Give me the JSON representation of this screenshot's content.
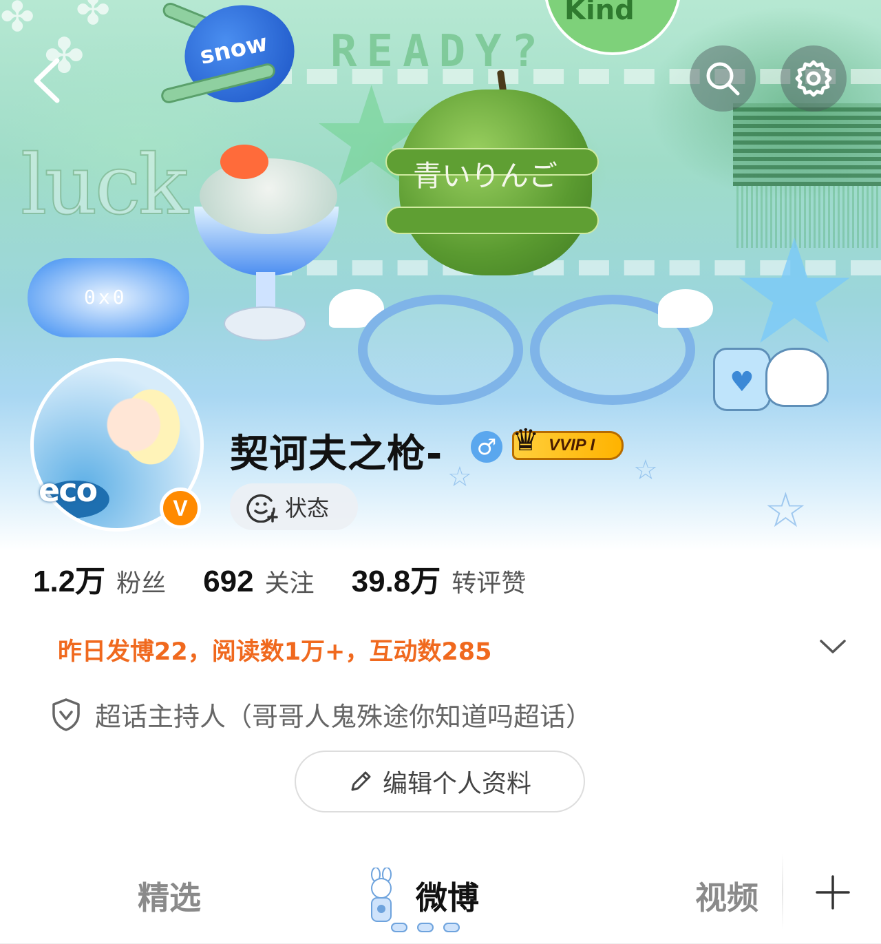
{
  "banner": {
    "deco_luck": "luck",
    "deco_ready": "READY?",
    "deco_kind": "Kind",
    "deco_snow": "snow",
    "deco_apple_text": "青いりんご",
    "deco_bubble": "0x0"
  },
  "header": {
    "back_icon": "chevron-left-icon",
    "search_icon": "search-icon",
    "settings_icon": "gear-icon"
  },
  "profile": {
    "avatar_text": "eco",
    "verified_badge": "V",
    "username": "契诃夫之枪-",
    "gender_symbol": "♂",
    "vip_label": "VVIP I",
    "status_label": "状态"
  },
  "stats": [
    {
      "value": "1.2万",
      "label": "粉丝"
    },
    {
      "value": "692",
      "label": "关注"
    },
    {
      "value": "39.8万",
      "label": "转评赞"
    }
  ],
  "summary": "昨日发博22，阅读数1万+，互动数285",
  "host": "超话主持人（哥哥人鬼殊途你知道吗超话）",
  "edit_button": "编辑个人资料",
  "tabs": [
    {
      "label": "精选",
      "active": false
    },
    {
      "label": "微博",
      "active": true
    },
    {
      "label": "视频",
      "active": false
    }
  ],
  "colors": {
    "summary": "#f0691e",
    "verified": "#ff8a00",
    "gender": "#5aa7ee",
    "vip": "#ffb300"
  }
}
